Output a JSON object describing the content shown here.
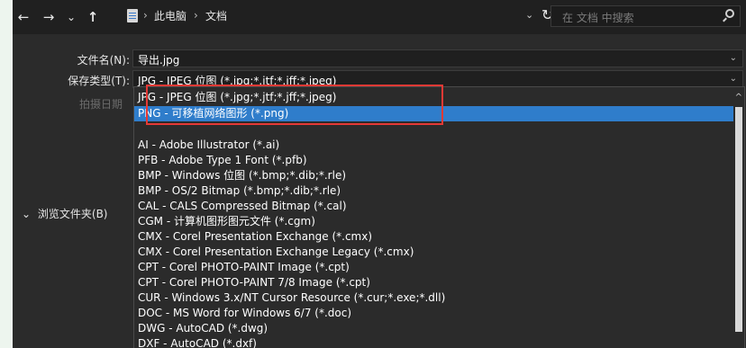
{
  "nav": {
    "back_icon": "←",
    "forward_icon": "→",
    "history_icon": "⌄",
    "up_icon": "↑",
    "crumbs": [
      "此电脑",
      "文档"
    ],
    "sep": "›",
    "ddl": "⌄",
    "refresh": "↻"
  },
  "search": {
    "placeholder": "在 文档 中搜索"
  },
  "form": {
    "filename_label": "文件名(N):",
    "filename_value": "导出.jpg",
    "savetype_label": "保存类型(T):",
    "savetype_value": "JPG - JPEG 位图 (*.jpg;*.jtf;*.jff;*.jpeg)",
    "ghost_label": "拍摄日期"
  },
  "browse_label": "浏览文件夹(B)",
  "browse_chevron": "⌄",
  "dropdown": {
    "items": [
      "JPG - JPEG 位图 (*.jpg;*.jtf;*.jff;*.jpeg)",
      "PNG - 可移植网络图形 (*.png)",
      "AI - Adobe Illustrator (*.ai)",
      "PFB - Adobe Type 1 Font (*.pfb)",
      "BMP - Windows 位图 (*.bmp;*.dib;*.rle)",
      "BMP - OS/2 Bitmap (*.bmp;*.dib;*.rle)",
      "CAL - CALS Compressed Bitmap (*.cal)",
      "CGM - 计算机图形图元文件 (*.cgm)",
      "CMX - Corel Presentation Exchange (*.cmx)",
      "CMX - Corel Presentation Exchange Legacy (*.cmx)",
      "CPT - Corel PHOTO-PAINT Image (*.cpt)",
      "CPT - Corel PHOTO-PAINT 7/8 Image (*.cpt)",
      "CUR - Windows 3.x/NT Cursor Resource (*.cur;*.exe;*.dll)",
      "DOC - MS Word for Windows 6/7 (*.doc)",
      "DWG - AutoCAD (*.dwg)",
      "DXF - AutoCAD (*.dxf)"
    ],
    "selected_index": 1
  },
  "colors": {
    "selection": "#2f7dcb",
    "highlight_box": "#e53935",
    "dialog_bg": "#2b2b2b"
  }
}
